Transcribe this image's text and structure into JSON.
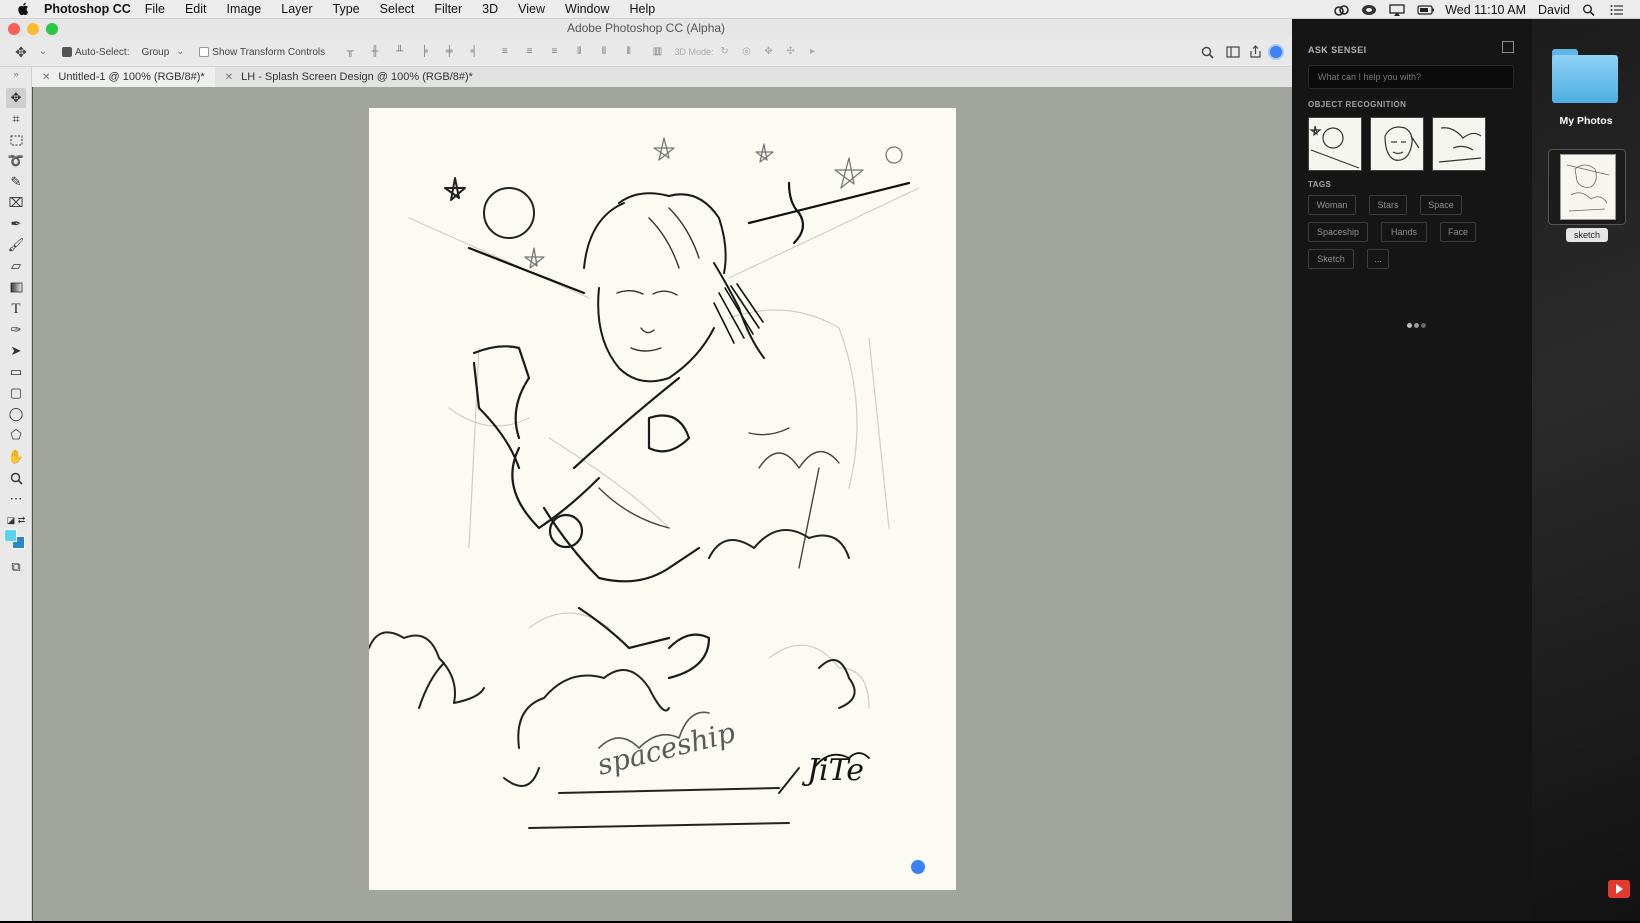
{
  "menubar": {
    "app_name": "Photoshop CC",
    "items": [
      "File",
      "Edit",
      "Image",
      "Layer",
      "Type",
      "Select",
      "Filter",
      "3D",
      "View",
      "Window",
      "Help"
    ],
    "clock": "Wed 11:10 AM",
    "user": "David"
  },
  "window": {
    "title": "Adobe Photoshop CC (Alpha)"
  },
  "options": {
    "auto_select_label": "Auto-Select:",
    "auto_select_value": "Group",
    "transform_label": "Show Transform Controls",
    "mode_label": "3D Mode:"
  },
  "tabs": [
    {
      "label": "Untitled-1 @ 100% (RGB/8#)*"
    },
    {
      "label": "LH - Splash Screen Design @ 100% (RGB/8#)*"
    }
  ],
  "sketch_text": {
    "word": "spaceship",
    "signature": "JiTe"
  },
  "sensei": {
    "header": "ASK SENSEI",
    "input_placeholder": "What can I help you with?",
    "object_recognition": "OBJECT RECOGNITION",
    "tags_header": "TAGS",
    "tags": [
      "Woman",
      "Stars",
      "Space",
      "Spaceship",
      "Hands",
      "Face",
      "Sketch",
      "..."
    ]
  },
  "desktop": {
    "folder_label": "My Photos",
    "file_label": "sketch"
  },
  "colors": {
    "accent": "#3b82f6",
    "foreground_swatch": "#5ad3ef",
    "background_swatch": "#2a87c8"
  }
}
